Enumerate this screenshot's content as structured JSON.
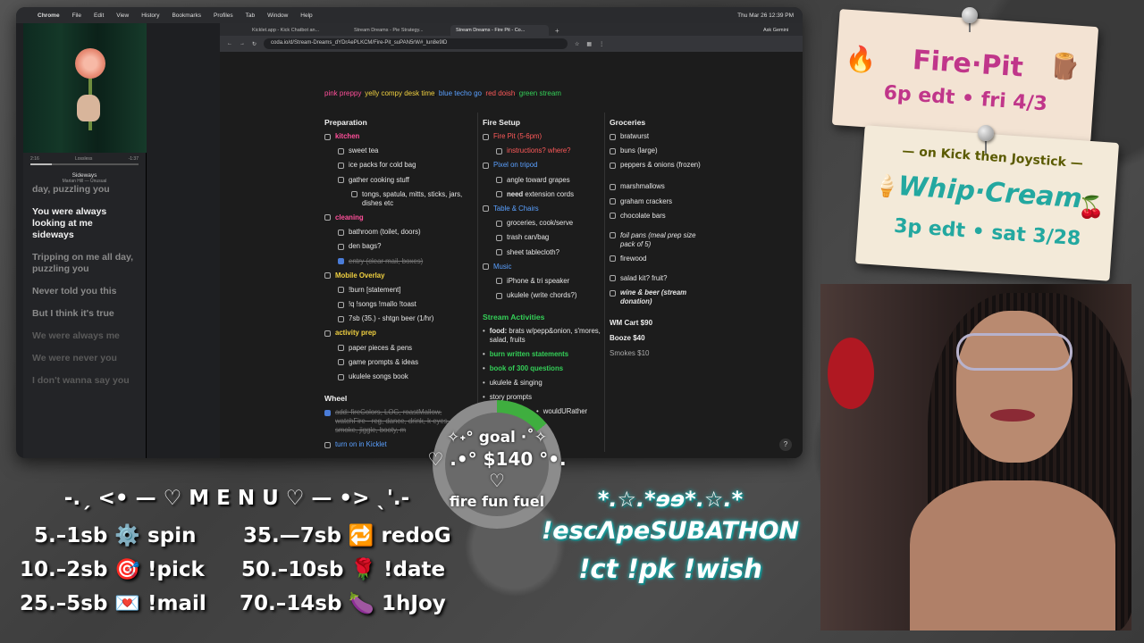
{
  "mac_menu": [
    "Chrome",
    "File",
    "Edit",
    "View",
    "History",
    "Bookmarks",
    "Profiles",
    "Tab",
    "Window",
    "Help"
  ],
  "mac_time": "Thu Mar 26  12:39 PM",
  "music": {
    "time_elapsed": "2:16",
    "quality": "Lossless",
    "time_remaining": "-1:37",
    "progress": 0.2,
    "song": "Sideways",
    "artist": "Marian Hill — Unusual",
    "lyrics": [
      "day, puzzling you",
      "You were always looking at me sideways",
      "Tripping on me all day, puzzling you",
      "Never told you this",
      "But I think it's true",
      "We were always me",
      "We were never you",
      "I don't wanna say you"
    ]
  },
  "browser": {
    "tabs": [
      "Kicklet.app - Kick Chatbot an...",
      "Stream Dreams - Pie Strategy...",
      "Stream Dreams - Fire Pit - Co..."
    ],
    "new_tab": "+",
    "gemini": "Ask Gemini",
    "url": "coda.io/d/Stream-Dreams_dYDrAePLKCM/Fire-Pit_suPAN5rW#_lun8e9lD"
  },
  "themes": {
    "pink": "pink preppy",
    "yellow": "yelly compy desk time",
    "blue": "blue techo go",
    "red": "red doish",
    "green": "green stream"
  },
  "preparation": {
    "title": "Preparation",
    "kitchen": "kitchen",
    "sweet_tea": "sweet tea",
    "ice_packs": "ice packs for cold bag",
    "gather": "gather cooking stuff",
    "tongs": "tongs, spatula, mitts, sticks, jars, dishes etc",
    "cleaning": "cleaning",
    "bathroom": "bathroom (toilet, doors)",
    "den_bags": "den bags?",
    "entry": "entry (clear mail, boxes)",
    "mobile_overlay": "Mobile Overlay",
    "burn": "!burn [statement]",
    "songs": "!q !songs !mallo !toast",
    "sb": "7sb (35.) - shtgn beer (1/hr)",
    "activity_prep": "activity prep",
    "paper": "paper pieces & pens",
    "game_prompts": "game prompts & ideas",
    "ukulele_book": "ukulele songs book"
  },
  "wheel": {
    "title": "Wheel",
    "add": "add: fireColors, LOG, roastMallow, watchFire - reg, dance, drink, k eyes, smoke, jiggle, booty, m",
    "turn_on": "turn on in  Kicklet"
  },
  "fire_setup": {
    "title": "Fire Setup",
    "fire_pit": "Fire Pit (5-6pm)",
    "instructions": "instructions? where?",
    "pixel": "Pixel on tripod",
    "angle": "angle toward grapes",
    "need_bold": "need",
    "need_rest": " extension cords",
    "table": "Table & Chairs",
    "groceries": "groceries, cook/serve",
    "trash": "trash can/bag",
    "sheet": "sheet tablecloth?",
    "music": "Music",
    "iphone": "iPhone & tri speaker",
    "ukulele": "ukulele (write chords?)"
  },
  "activities": {
    "title": "Stream Activities",
    "food_bold": "food:",
    "food_rest": " brats w/pepp&onion, s'mores, salad, fruits",
    "burn": "burn written statements",
    "book": "book of 300 questions",
    "ukulele": "ukulele & singing",
    "story": "story prompts",
    "would": "wouldURather"
  },
  "groceries": {
    "title": "Groceries",
    "items": [
      "bratwurst",
      "buns (large)",
      "peppers & onions (frozen)",
      "marshmallows",
      "graham crackers",
      "chocolate bars",
      "foil pans (meal prep size pack of 5)",
      "firewood",
      "salad kit? fruit?",
      "wine & beer (stream donation)"
    ],
    "cart1": "WM Cart $90",
    "cart2": "Booze $40",
    "cart3": "Smokes $10"
  },
  "help": "?",
  "goal": {
    "label": "✧˖° goal ·˚✧",
    "amount": "♡ .•° $140 °•. ♡",
    "name": "fire fun fuel",
    "progress": 0.14
  },
  "menu": {
    "title": "-.ˏ <• — ♡ M E N U ♡ — •> ˎ'.-",
    "items": [
      "5.–1sb ⚙️ spin",
      "10.–2sb 🎯 !pick",
      "25.–5sb 💌 !mail",
      "35.—7sb 🔁 redoG",
      "50.–10sb 🌹 !date",
      "70.–14sb 🍆 1hJoy"
    ]
  },
  "subathon": {
    "line1": "*.☆.*ɘɘ*.☆.*",
    "line2": "!escΛpeSUBATHON",
    "line3": "!ct !pk !wish"
  },
  "card1": {
    "title": "Fire·Pit",
    "sub": "6p edt • fri 4/3",
    "emoji_left": "🔥",
    "emoji_right": "🪵"
  },
  "card2": {
    "top": "— on Kick then Joystick —",
    "title": "Whip·Cream",
    "sub": "3p edt • sat 3/28",
    "emoji_left": "🍦",
    "emoji_right": "🍒"
  },
  "colors": {
    "pink": "#ff4f9a",
    "yellow": "#f0d040",
    "blue": "#5aa0ff",
    "red": "#ff5a5a",
    "green": "#34d058",
    "goal_fill": "#3fae3f",
    "subathon_glow": "#25b0b0"
  }
}
